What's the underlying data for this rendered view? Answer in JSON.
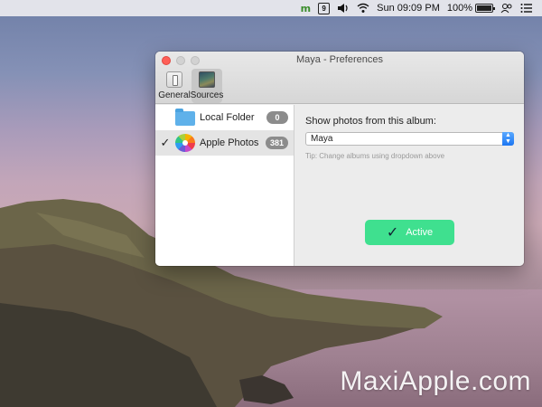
{
  "menubar": {
    "items": [
      {
        "icon": "maya-icon",
        "text": "m"
      },
      {
        "icon": "calendar-icon",
        "text": "9"
      },
      {
        "icon": "volume-icon",
        "text": "🔊"
      },
      {
        "icon": "wifi-icon",
        "text": "📶"
      }
    ],
    "clock": "Sun 09:09 PM",
    "battery_percent": "100%",
    "battery_level": 1.0
  },
  "window": {
    "title": "Maya - Preferences",
    "toolbar": [
      {
        "label": "General",
        "selected": false
      },
      {
        "label": "Sources",
        "selected": true
      }
    ]
  },
  "sidebar": {
    "items": [
      {
        "label": "Local Folder",
        "count": "0",
        "checked": false,
        "icon": "folder-icon",
        "check": ""
      },
      {
        "label": "Apple Photos",
        "count": "381",
        "checked": true,
        "icon": "photos-icon",
        "check": "✓"
      }
    ]
  },
  "content": {
    "album_label": "Show photos from this album:",
    "album_value": "Maya",
    "tip": "Tip: Change albums using dropdown above",
    "active_label": "Active",
    "active_check": "✓"
  },
  "colors": {
    "active_button": "#3fe08f",
    "close_light": "#fe5f57",
    "select_accent": "#1c76f2"
  },
  "watermark": "MaxiApple.com"
}
